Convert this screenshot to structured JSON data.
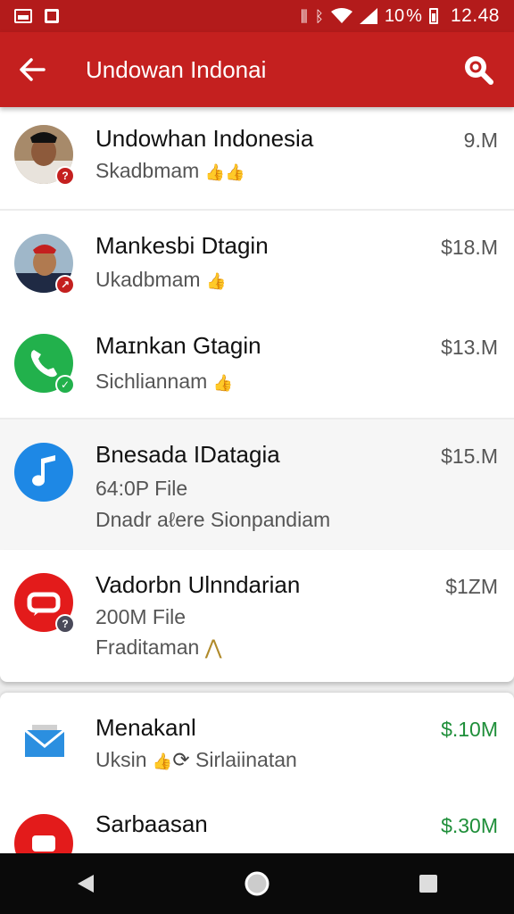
{
  "status_bar": {
    "signal_text": "10",
    "battery_pct": "%",
    "time": "12.48"
  },
  "app_bar": {
    "title": "Undowan Indonai",
    "back_icon": "arrow-left-icon",
    "search_icon": "search-icon"
  },
  "items": [
    {
      "name": "Undowhan Indonesia",
      "sub": "Skadbmam",
      "size": "9.M",
      "icon": "profile-photo",
      "badge": "?"
    },
    {
      "name": "Mankesbi Dtagin",
      "sub": "Ukadbmam",
      "size": "$18.M",
      "icon": "profile-photo",
      "badge": "↗"
    },
    {
      "name": "Maɪnkan Gtagin",
      "sub": "Sichliannam",
      "size": "$13.M",
      "icon": "phone-icon",
      "badge": "✓"
    },
    {
      "name": "Bnesada IDatagia",
      "sub": "64:0P File",
      "sub2": "Dnadr aℓere Sionpandiam",
      "size": "$15.M",
      "icon": "music-note-icon"
    },
    {
      "name": "Vadorbn Ulnndarian",
      "sub": "200M File",
      "sub2": "Fraditaman",
      "size": "$1ZM",
      "icon": "chat-icon",
      "badge": "?"
    },
    {
      "name": "Menakanl",
      "sub": "Uksin",
      "sub_extra": "Sirlaiinatan",
      "size": "$.10M",
      "icon": "mail-icon"
    },
    {
      "name": "Sarbaasan",
      "sub": "",
      "size": "$.30M",
      "icon": "chat-icon"
    }
  ],
  "colors": {
    "app_bar": "#c4201f",
    "status_bar": "#b31b1b",
    "accent_green": "#1f8f3a"
  }
}
